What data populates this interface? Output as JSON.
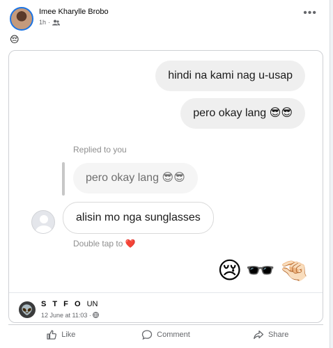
{
  "post": {
    "author": "Imee Kharylle Brobo",
    "time": "1h",
    "audience_icon": "friends-icon",
    "caption": "😔"
  },
  "card": {
    "messages": [
      {
        "text": "hindi na kami nag u-usap"
      },
      {
        "text": "pero okay lang 😎😎"
      }
    ],
    "replied_label": "Replied to you",
    "quoted": "pero okay lang 😎😎",
    "reply": "alisin mo nga sunglasses",
    "double_tap": "Double tap to ❤️",
    "emojis": [
      "😢",
      "🕶️",
      "🤏🏻"
    ],
    "page": {
      "name_bold": "S T F O ",
      "name_rest": "UN",
      "date": "12 June at 11:03 · ",
      "globe_icon": "globe-icon"
    }
  },
  "actions": {
    "like": "Like",
    "comment": "Comment",
    "share": "Share"
  }
}
